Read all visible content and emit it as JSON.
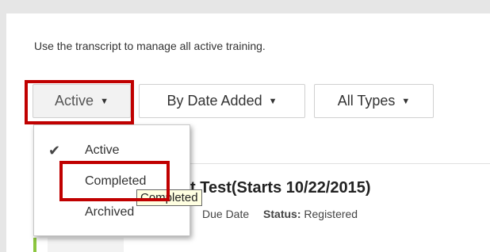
{
  "page": {
    "subtitle": "Use the transcript to manage all active training."
  },
  "filters": {
    "status_label": "Active",
    "sort_label": "By Date Added",
    "type_label": "All Types"
  },
  "status_menu": {
    "items": [
      {
        "label": "Active",
        "selected": true
      },
      {
        "label": "Completed",
        "selected": false
      },
      {
        "label": "Archived",
        "selected": false
      }
    ]
  },
  "tooltip": {
    "text": "Completed"
  },
  "transcript_item": {
    "title_visible": "t Test(Starts 10/22/2015)",
    "due_label": "Due Date",
    "status_label": "Status:",
    "status_value": "Registered"
  },
  "colors": {
    "highlight_red": "#c00000",
    "accent_green": "#8cc63f"
  }
}
